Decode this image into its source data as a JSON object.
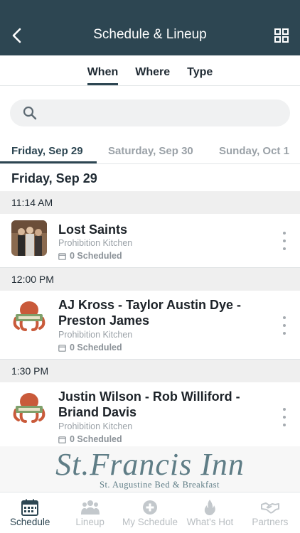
{
  "header": {
    "title": "Schedule & Lineup",
    "back_icon": "chevron-left-icon",
    "grid_icon": "grid-icon"
  },
  "mode_tabs": [
    {
      "label": "When",
      "active": true
    },
    {
      "label": "Where",
      "active": false
    },
    {
      "label": "Type",
      "active": false
    }
  ],
  "search": {
    "icon": "search-icon",
    "placeholder": ""
  },
  "date_tabs": [
    {
      "label": "Friday, Sep 29",
      "active": true
    },
    {
      "label": "Saturday, Sep 30",
      "active": false
    },
    {
      "label": "Sunday, Oct 1",
      "active": false
    }
  ],
  "day_heading": "Friday, Sep 29",
  "slots": [
    {
      "time": "11:14 AM",
      "event": {
        "name": "Lost Saints",
        "venue": "Prohibition Kitchen",
        "scheduled": "0 Scheduled",
        "thumb": "band-photo"
      }
    },
    {
      "time": "12:00 PM",
      "event": {
        "name": "AJ Kross - Taylor Austin Dye - Preston James",
        "venue": "Prohibition Kitchen",
        "scheduled": "0 Scheduled",
        "thumb": "octopus-logo"
      }
    },
    {
      "time": "1:30 PM",
      "event": {
        "name": "Justin Wilson - Rob Williford - Briand Davis",
        "venue": "Prohibition Kitchen",
        "scheduled": "0 Scheduled",
        "thumb": "octopus-logo"
      }
    }
  ],
  "banner": {
    "line1": "St.Francis Inn",
    "line2": "St. Augustine Bed & Breakfast"
  },
  "tabbar": [
    {
      "label": "Schedule",
      "icon": "calendar-icon",
      "active": true
    },
    {
      "label": "Lineup",
      "icon": "people-icon",
      "active": false
    },
    {
      "label": "My Schedule",
      "icon": "plus-circle-icon",
      "active": false
    },
    {
      "label": "What's Hot",
      "icon": "flame-icon",
      "active": false
    },
    {
      "label": "Partners",
      "icon": "handshake-icon",
      "active": false
    }
  ],
  "colors": {
    "header_bg": "#2d4652",
    "accent": "#2d4652",
    "muted": "#9aa1a7",
    "band": "#efefef"
  }
}
